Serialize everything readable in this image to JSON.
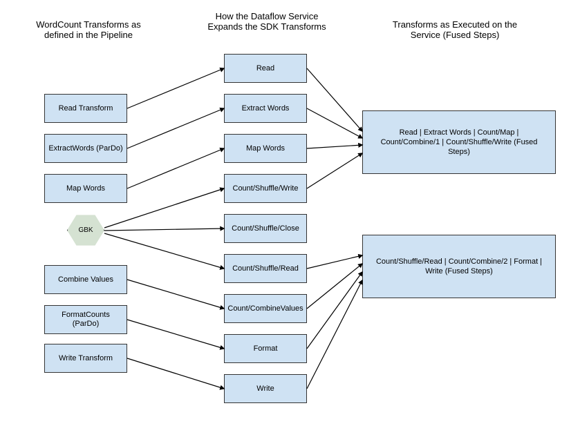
{
  "columns": {
    "a": {
      "title": "WordCount Transforms as defined in the Pipeline"
    },
    "b": {
      "title": "How the Dataflow Service Expands the SDK Transforms"
    },
    "c": {
      "title": "Transforms as Executed on the Service (Fused Steps)"
    }
  },
  "colA": [
    {
      "id": "a-read",
      "label": "Read Transform"
    },
    {
      "id": "a-extract",
      "label": "ExtractWords (ParDo)"
    },
    {
      "id": "a-map",
      "label": "Map Words"
    },
    {
      "id": "a-gbk",
      "label": "GBK"
    },
    {
      "id": "a-combine",
      "label": "Combine Values"
    },
    {
      "id": "a-format",
      "label": "FormatCounts (ParDo)"
    },
    {
      "id": "a-write",
      "label": "Write Transform"
    }
  ],
  "colB": [
    {
      "id": "b-read",
      "label": "Read"
    },
    {
      "id": "b-extract",
      "label": "Extract Words"
    },
    {
      "id": "b-map",
      "label": "Map Words"
    },
    {
      "id": "b-cshw",
      "label": "Count/Shuffle/Write"
    },
    {
      "id": "b-cshc",
      "label": "Count/Shuffle/Close"
    },
    {
      "id": "b-cshr",
      "label": "Count/Shuffle/Read"
    },
    {
      "id": "b-ccv",
      "label": "Count/CombineValues"
    },
    {
      "id": "b-format",
      "label": "Format"
    },
    {
      "id": "b-write",
      "label": "Write"
    }
  ],
  "colC": [
    {
      "id": "c-fused1",
      "label": "Read | Extract Words | Count/Map | Count/Combine/1 | Count/Shuffle/Write\n(Fused Steps)"
    },
    {
      "id": "c-fused2",
      "label": "Count/Shuffle/Read | Count/Combine/2 | Format | Write\n(Fused Steps)"
    }
  ]
}
